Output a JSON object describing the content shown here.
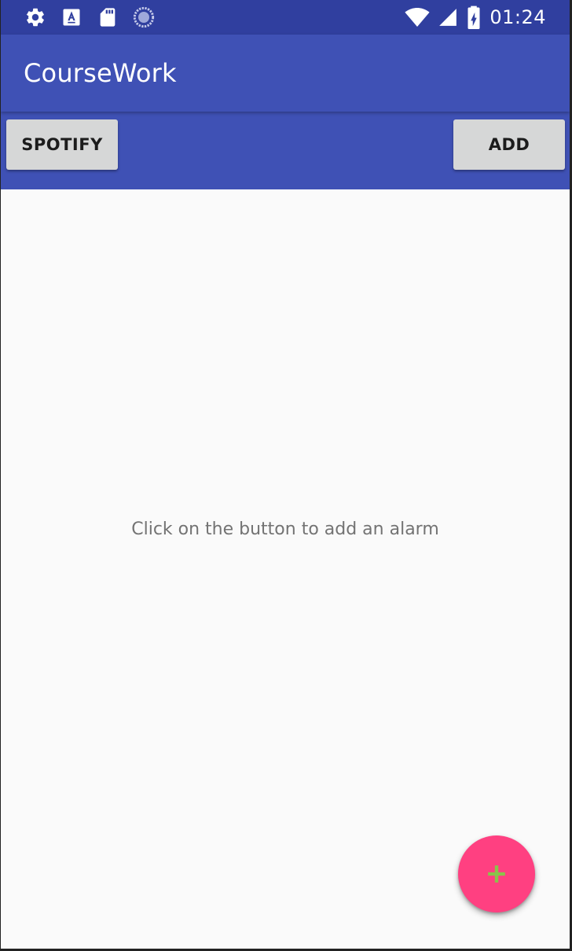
{
  "status_bar": {
    "time": "01:24",
    "left_icons": [
      "settings-icon",
      "font-a-icon",
      "sd-card-icon",
      "sync-progress-icon"
    ],
    "right_icons": [
      "wifi-icon",
      "signal-icon",
      "battery-charging-icon"
    ]
  },
  "app_bar": {
    "title": "CourseWork"
  },
  "toolbar": {
    "spotify_label": "SPOTIFY",
    "add_label": "ADD"
  },
  "content": {
    "empty_message": "Click on the button to add an alarm"
  },
  "fab": {
    "icon": "plus-icon"
  },
  "colors": {
    "status_bar": "#303f9f",
    "primary": "#3f51b5",
    "accent": "#ff4081",
    "fab_icon": "#8bc34a",
    "background": "#fafafa",
    "button": "#d6d7d7"
  }
}
